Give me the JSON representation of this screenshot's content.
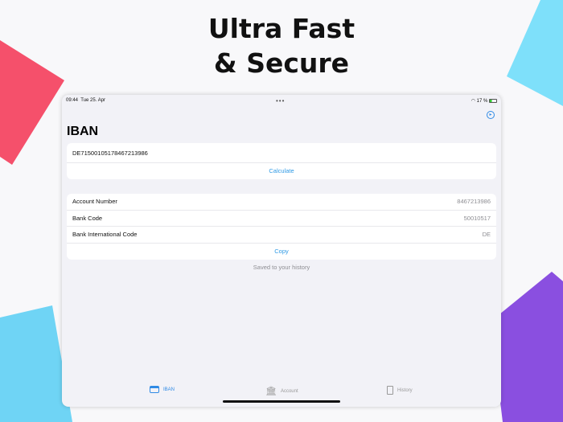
{
  "headline": {
    "line1": "Ultra Fast",
    "line2": "& Secure"
  },
  "status": {
    "time": "09:44",
    "date": "Tue 25. Apr",
    "battery": "17 %"
  },
  "page_title": "IBAN",
  "iban_input": {
    "value": "DE71500105178467213986"
  },
  "calculate_label": "Calculate",
  "results": [
    {
      "label": "Account Number",
      "value": "8467213986"
    },
    {
      "label": "Bank Code",
      "value": "50010517"
    },
    {
      "label": "Bank International Code",
      "value": "DE"
    }
  ],
  "copy_label": "Copy",
  "saved_text": "Saved to your history",
  "tabs": [
    {
      "label": "IBAN",
      "icon": "card-icon"
    },
    {
      "label": "Account",
      "icon": "bank-icon"
    },
    {
      "label": "History",
      "icon": "clipboard-icon"
    }
  ],
  "colors": {
    "accent": "#2f8ae5"
  }
}
